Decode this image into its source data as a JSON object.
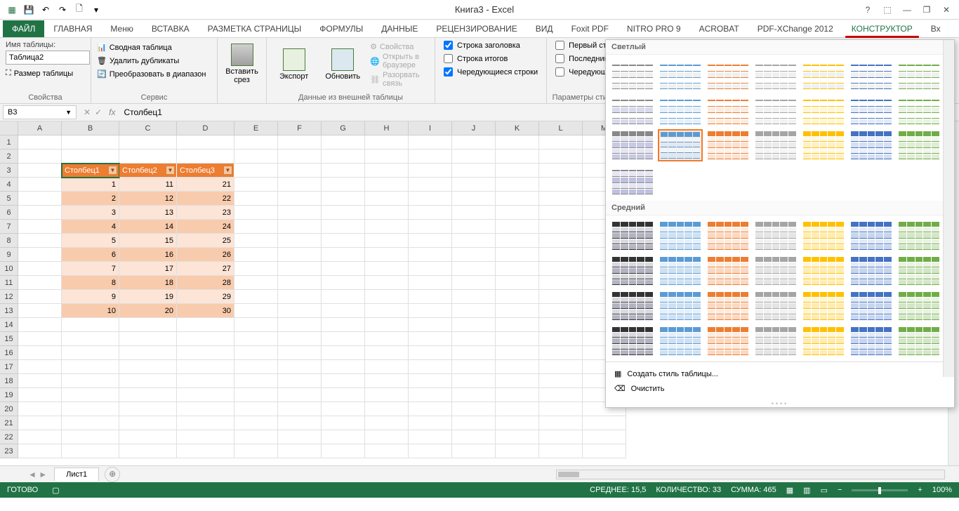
{
  "app_title": "Книга3 - Excel",
  "qa": {
    "save": "💾",
    "undo": "↶",
    "redo": "↷",
    "new": "🗋"
  },
  "win": {
    "help": "?",
    "ribbon": "⬚",
    "min": "—",
    "max": "❐",
    "close": "✕"
  },
  "tabs": [
    "ФАЙЛ",
    "ГЛАВНАЯ",
    "Меню",
    "ВСТАВКА",
    "РАЗМЕТКА СТРАНИЦЫ",
    "ФОРМУЛЫ",
    "ДАННЫЕ",
    "РЕЦЕНЗИРОВАНИЕ",
    "ВИД",
    "Foxit PDF",
    "NITRO PRO 9",
    "ACROBAT",
    "PDF-XChange 2012",
    "КОНСТРУКТОР",
    "Вх"
  ],
  "active_tab": 13,
  "ribbon": {
    "prop": {
      "label": "Имя таблицы:",
      "value": "Таблица2",
      "resize": "Размер таблицы",
      "group": "Свойства"
    },
    "service": {
      "pivot": "Сводная таблица",
      "dedup": "Удалить дубликаты",
      "convert": "Преобразовать в диапазон",
      "group": "Сервис"
    },
    "slicer": {
      "label": "Вставить\nсрез"
    },
    "export": {
      "label": "Экспорт"
    },
    "refresh": {
      "label": "Обновить"
    },
    "extdata": {
      "props": "Свойства",
      "browser": "Открыть в браузере",
      "unlink": "Разорвать связь",
      "group": "Данные из внешней таблицы"
    },
    "opts1": {
      "header": "Строка заголовка",
      "total": "Строка итогов",
      "banded": "Чередующиеся строки"
    },
    "opts2": {
      "firstcol": "Первый ст",
      "lastcol": "Последний",
      "bandedcol": "Чередующ"
    },
    "opts_group": "Параметры стил"
  },
  "formula": {
    "cell": "B3",
    "fx": "fx",
    "value": "Столбец1"
  },
  "cols": [
    "A",
    "B",
    "C",
    "D",
    "E",
    "F",
    "G",
    "H",
    "I",
    "J",
    "K",
    "L",
    "M"
  ],
  "rows": [
    1,
    2,
    3,
    4,
    5,
    6,
    7,
    8,
    9,
    10,
    11,
    12,
    13,
    14,
    15,
    16,
    17,
    18,
    19,
    20,
    21,
    22,
    23
  ],
  "table": {
    "headers": [
      "Столбец1",
      "Столбец2",
      "Столбец3"
    ],
    "data": [
      [
        1,
        11,
        21
      ],
      [
        2,
        12,
        22
      ],
      [
        3,
        13,
        23
      ],
      [
        4,
        14,
        24
      ],
      [
        5,
        15,
        25
      ],
      [
        6,
        16,
        26
      ],
      [
        7,
        17,
        27
      ],
      [
        8,
        18,
        28
      ],
      [
        9,
        19,
        29
      ],
      [
        10,
        20,
        30
      ]
    ]
  },
  "sheet_tab": "Лист1",
  "status": {
    "ready": "ГОТОВО",
    "avg": "СРЕДНЕЕ: 15,5",
    "count": "КОЛИЧЕСТВО: 33",
    "sum": "СУММА: 465",
    "zoom": "100%"
  },
  "gallery": {
    "light": "Светлый",
    "medium": "Средний",
    "new_style": "Создать стиль таблицы...",
    "clear": "Очистить"
  },
  "light_colors": [
    "#888",
    "#5b9bd5",
    "#ed7d31",
    "#a5a5a5",
    "#ffc000",
    "#4472c4",
    "#70ad47"
  ],
  "medium_colors": [
    "#333",
    "#5b9bd5",
    "#ed7d31",
    "#a5a5a5",
    "#ffc000",
    "#4472c4",
    "#70ad47"
  ]
}
